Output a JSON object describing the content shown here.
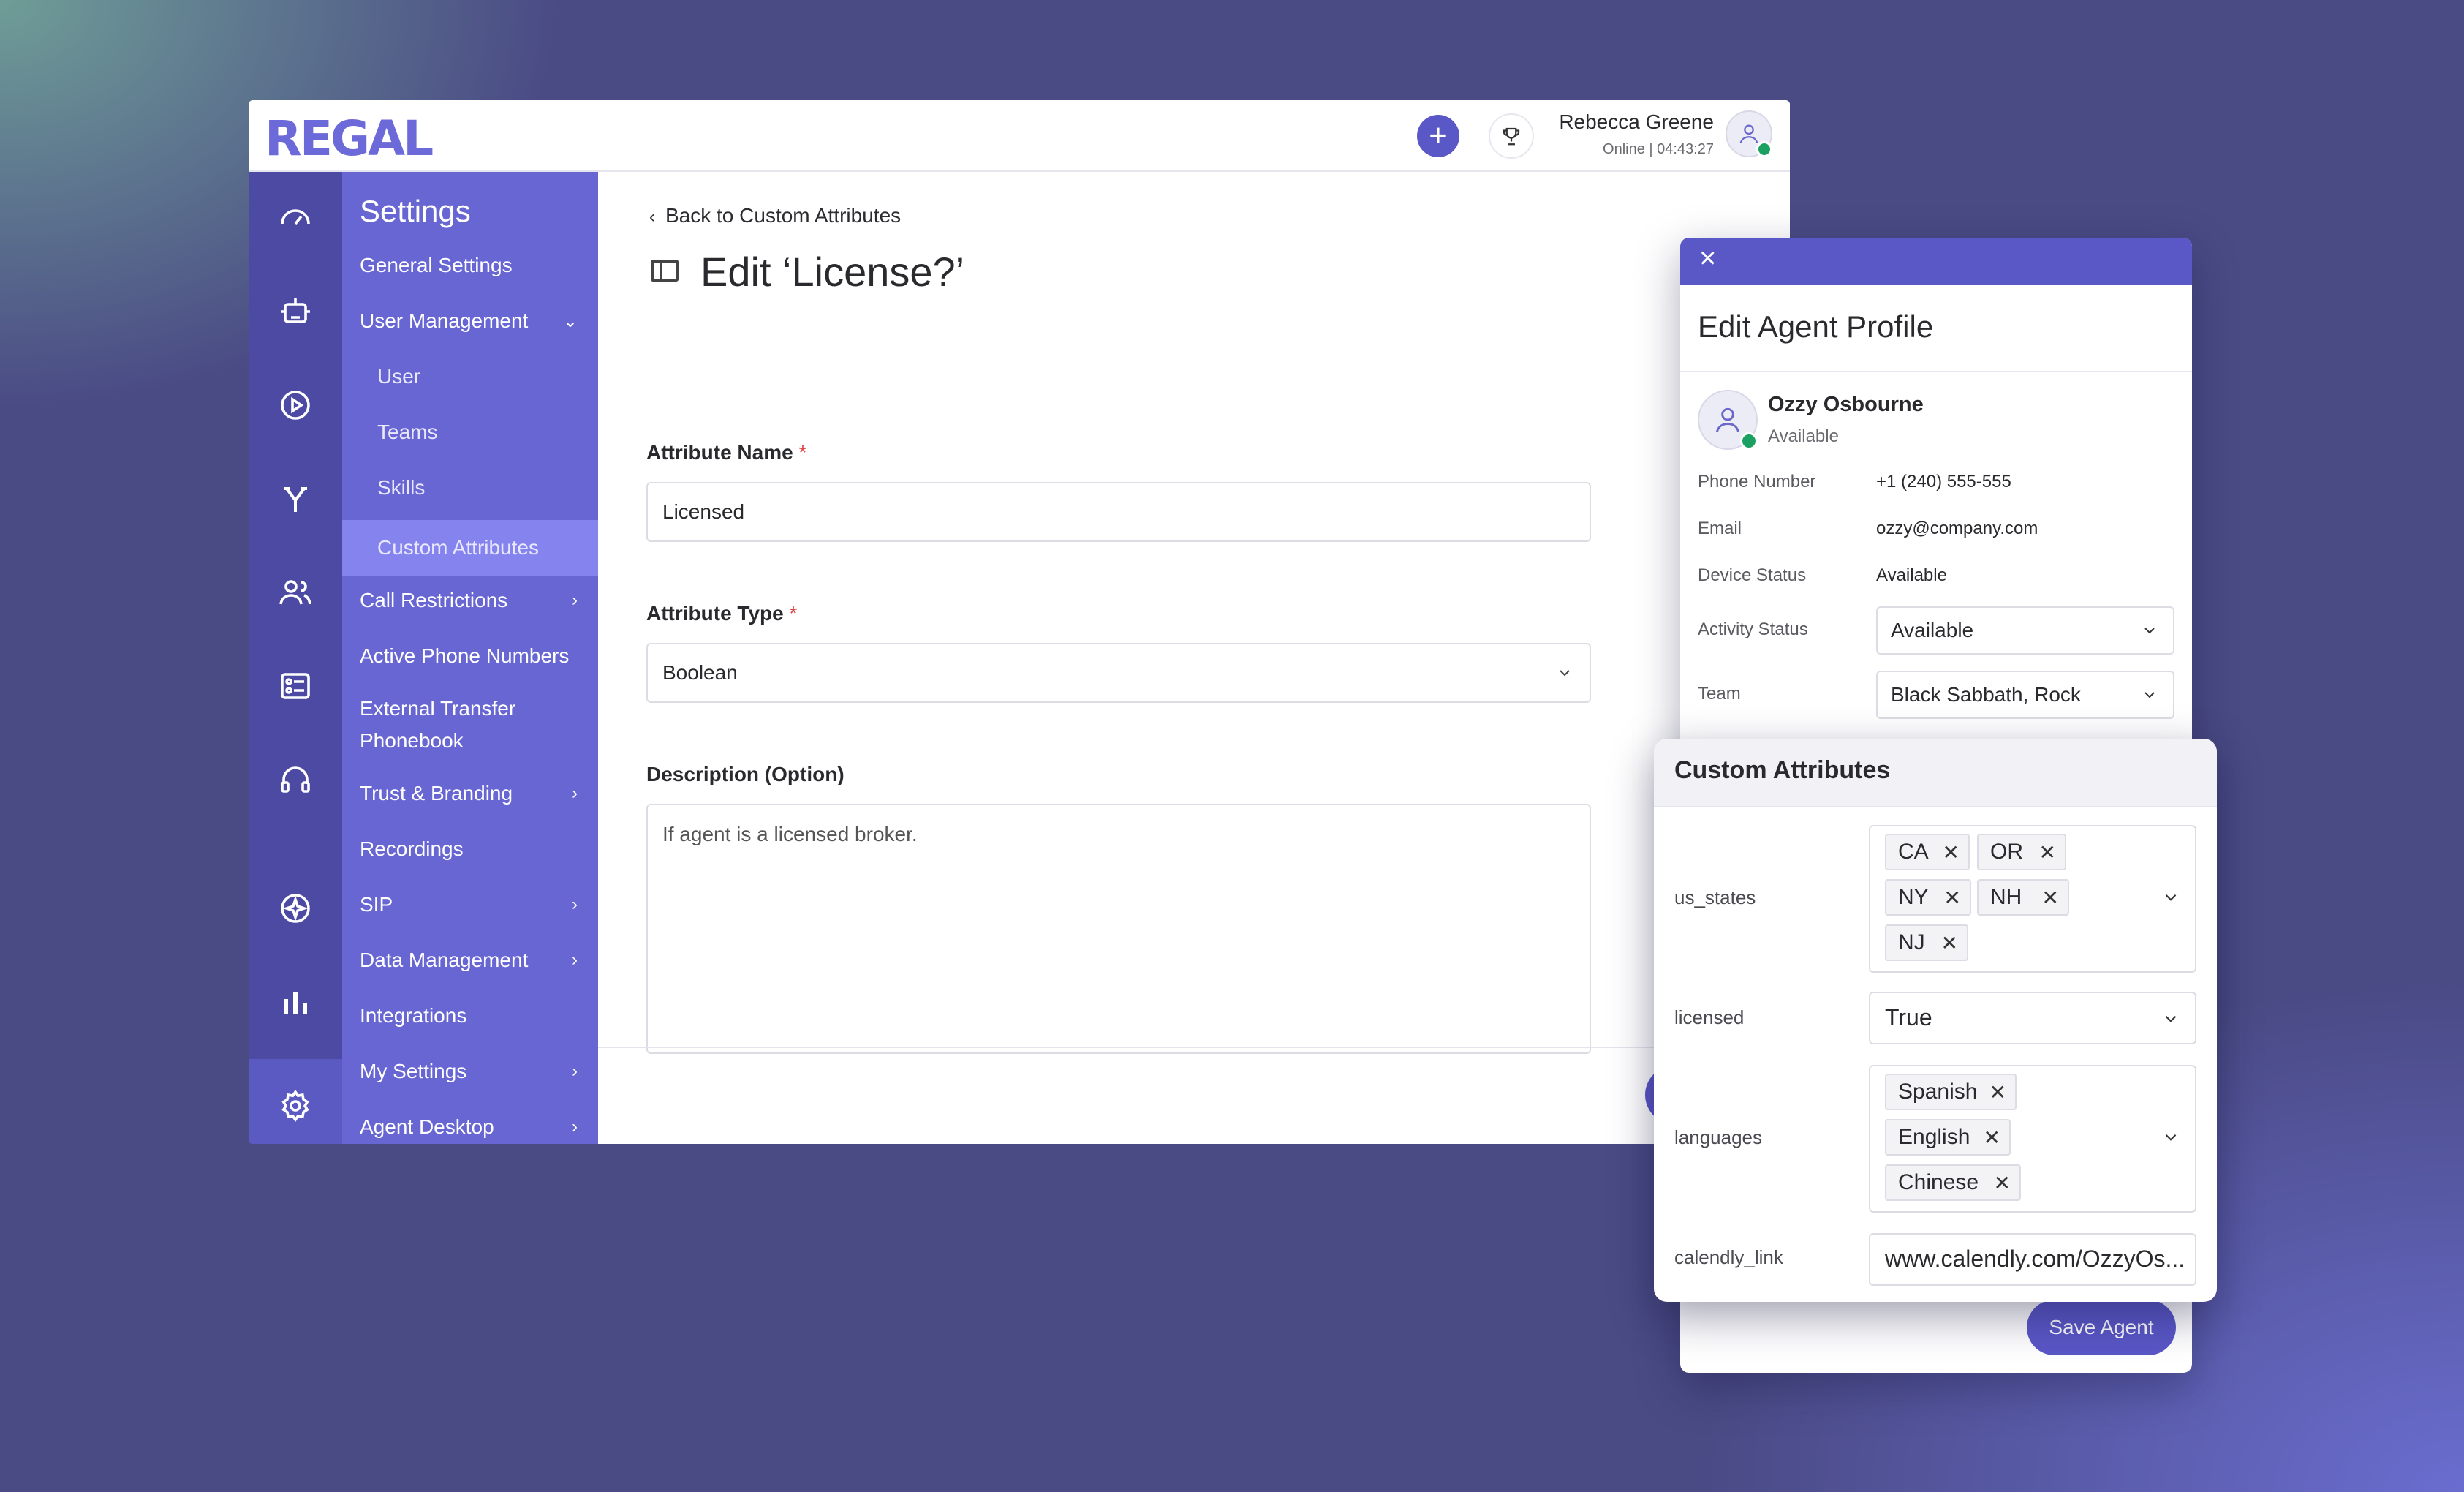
{
  "brand": {
    "logo": "REGAL",
    "accent": "#5a57c7",
    "sidebar_bg": "#6866d2",
    "rail_bg": "#4c4aa3"
  },
  "topbar": {
    "user_name": "Rebecca Greene",
    "user_status": "Online | 04:43:27"
  },
  "rail": {
    "icons": [
      "dashboard-icon",
      "bot-icon",
      "play-icon",
      "branch-icon",
      "users-icon",
      "list-icon",
      "headset-icon",
      "sparkle-icon",
      "bar-chart-icon",
      "gear-icon"
    ]
  },
  "sidebar": {
    "title": "Settings",
    "items": [
      {
        "label": "General Settings"
      },
      {
        "label": "User Management",
        "chevron": "⌄"
      },
      {
        "label": "User"
      },
      {
        "label": "Teams"
      },
      {
        "label": "Skills"
      },
      {
        "label": "Custom Attributes"
      },
      {
        "label": "Call Restrictions",
        "chevron": "›"
      },
      {
        "label": "Active Phone Numbers"
      },
      {
        "label": "External Transfer Phonebook"
      },
      {
        "label": "Trust & Branding",
        "chevron": "›"
      },
      {
        "label": "Recordings"
      },
      {
        "label": "SIP",
        "chevron": "›"
      },
      {
        "label": "Data Management",
        "chevron": "›"
      },
      {
        "label": "Integrations"
      },
      {
        "label": "My Settings",
        "chevron": "›"
      },
      {
        "label": "Agent Desktop",
        "chevron": "›"
      }
    ]
  },
  "main": {
    "back_link": "Back to Custom Attributes",
    "title": "Edit ‘License?’",
    "name_label": "Attribute Name",
    "name_value": "Licensed",
    "type_label": "Attribute Type",
    "type_value": "Boolean",
    "desc_label": "Description (Option)",
    "desc_value": "If agent is a licensed broker.",
    "required_mark": "*"
  },
  "profile": {
    "title": "Edit Agent Profile",
    "agent_name": "Ozzy Osbourne",
    "agent_status": "Available",
    "phone_label": "Phone Number",
    "phone_value": "+1 (240) 555-555",
    "email_label": "Email",
    "email_value": "ozzy@company.com",
    "device_label": "Device Status",
    "device_value": "Available",
    "activity_label": "Activity Status",
    "activity_value": "Available",
    "team_label": "Team",
    "team_value": "Black Sabbath, Rock",
    "save_label": "Save Agent"
  },
  "attributes": {
    "title": "Custom Attributes",
    "us_states_label": "us_states",
    "us_states": [
      "CA",
      "OR",
      "NY",
      "NH",
      "NJ"
    ],
    "licensed_label": "licensed",
    "licensed_value": "True",
    "languages_label": "languages",
    "languages": [
      "Spanish",
      "English",
      "Chinese"
    ],
    "calendly_label": "calendly_link",
    "calendly_value": "www.calendly.com/OzzyOs..."
  }
}
